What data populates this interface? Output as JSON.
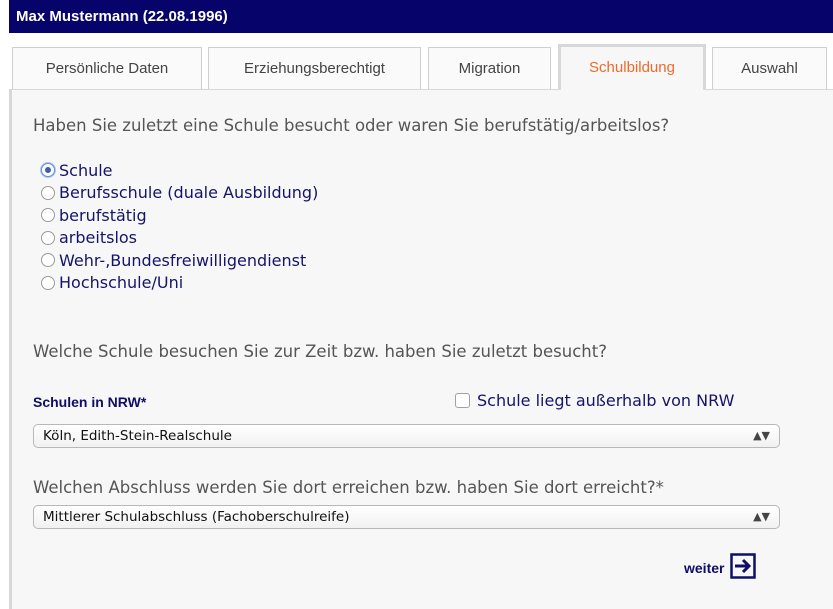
{
  "header": {
    "title": "Max Mustermann (22.08.1996)"
  },
  "tabs": [
    {
      "label": "Persönliche Daten",
      "active": false
    },
    {
      "label": "Erziehungsberechtigt",
      "active": false
    },
    {
      "label": "Migration",
      "active": false
    },
    {
      "label": "Schulbildung",
      "active": true
    },
    {
      "label": "Auswahl",
      "active": false
    }
  ],
  "question1": "Haben Sie zuletzt eine Schule besucht oder waren Sie berufstätig/arbeitslos?",
  "options": [
    {
      "label": "Schule",
      "checked": true
    },
    {
      "label": "Berufsschule (duale Ausbildung)",
      "checked": false
    },
    {
      "label": "berufstätig",
      "checked": false
    },
    {
      "label": "arbeitslos",
      "checked": false
    },
    {
      "label": "Wehr-,Bundesfreiwilligendienst",
      "checked": false
    },
    {
      "label": "Hochschule/Uni",
      "checked": false
    }
  ],
  "question2": "Welche Schule besuchen Sie zur Zeit bzw. haben Sie zuletzt besucht?",
  "school": {
    "label": "Schulen in NRW*",
    "outside_label": "Schule liegt außerhalb von NRW",
    "outside_checked": false,
    "selected": "Köln, Edith-Stein-Realschule"
  },
  "question3": "Welchen Abschluss werden Sie dort erreichen bzw. haben Sie dort erreicht?*",
  "degree": {
    "selected": "Mittlerer Schulabschluss (Fachoberschulreife)"
  },
  "next_label": "weiter",
  "colors": {
    "header_bg": "#06046a",
    "active_tab": "#ee6a2b",
    "label_blue": "#0e0e66"
  }
}
